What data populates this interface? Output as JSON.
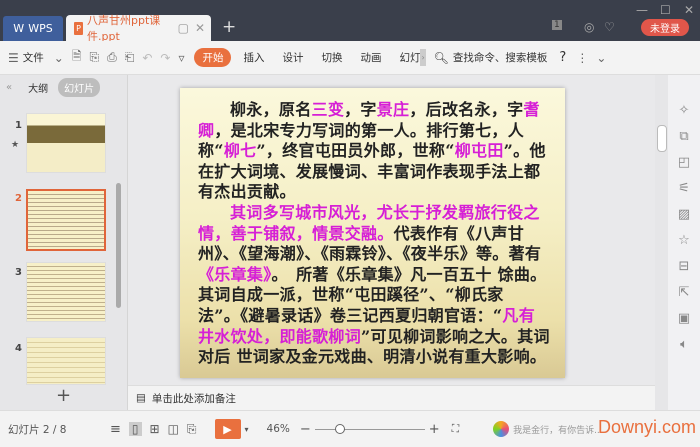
{
  "titlebar": {
    "wps_tab": "WPS",
    "doc_tab": "八声甘州ppt课件.ppt",
    "doc_icon": "P",
    "badge": "1",
    "login": "未登录"
  },
  "toolbar": {
    "file": "文件",
    "start": "开始",
    "tabs": [
      "插入",
      "设计",
      "切换",
      "动画",
      "幻灯"
    ],
    "search": "查找命令、搜索模板",
    "help": "?"
  },
  "leftpanel": {
    "outline": "大纲",
    "slides": "幻灯片",
    "thumb_numbers": [
      "1",
      "2",
      "3",
      "4"
    ],
    "add": "+"
  },
  "slide": {
    "paragraphs": [
      [
        {
          "t": "柳永，原名"
        },
        {
          "t": "三变",
          "c": "pink"
        },
        {
          "t": "，字"
        },
        {
          "t": "景庄",
          "c": "pink"
        },
        {
          "t": "，后改名永，字"
        },
        {
          "t": "耆卿",
          "c": "pink"
        },
        {
          "t": "，是北宋专力写词的第一人。排行第七，人称“"
        },
        {
          "t": "柳七",
          "c": "pink"
        },
        {
          "t": "”，终官屯田员外郎，世称“"
        },
        {
          "t": "柳屯田",
          "c": "pink"
        },
        {
          "t": "”。他在扩大词境、发展慢词、丰富词作表现手法上都有杰出贡献。"
        }
      ],
      [
        {
          "t": "其词多写城市风光，尤长于抒发羁旅行役之情，善于铺叙，情景交融。",
          "c": "pink"
        },
        {
          "t": "代表作有《八声甘州》、《望海潮》、《雨霖铃》、《夜半乐》等。著有"
        },
        {
          "t": "《乐章集》",
          "c": "pink"
        },
        {
          "t": "。　所著《乐章集》凡一百五十 馀曲。其词自成一派，世称“屯田蹊径”、“柳氏家 法”。《避暑录话》卷三记西夏归朝官语：“"
        },
        {
          "t": "凡有井水饮处，即能歌柳词",
          "c": "pink"
        },
        {
          "t": "”可见柳词影响之大。其词对后 世词家及金元戏曲、明清小说有重大影响。"
        }
      ]
    ]
  },
  "notes": {
    "placeholder": "单击此处添加备注"
  },
  "status": {
    "slide_counter": "幻灯片 2 / 8",
    "zoom": "46%",
    "zoom_fraction": 0.46,
    "assistant": "我是金行，有你告诉...",
    "watermark": "Downyi.com"
  },
  "colors": {
    "accent": "#e9703e",
    "highlight": "#d61fd6",
    "titlebar": "#3a3f4b"
  }
}
